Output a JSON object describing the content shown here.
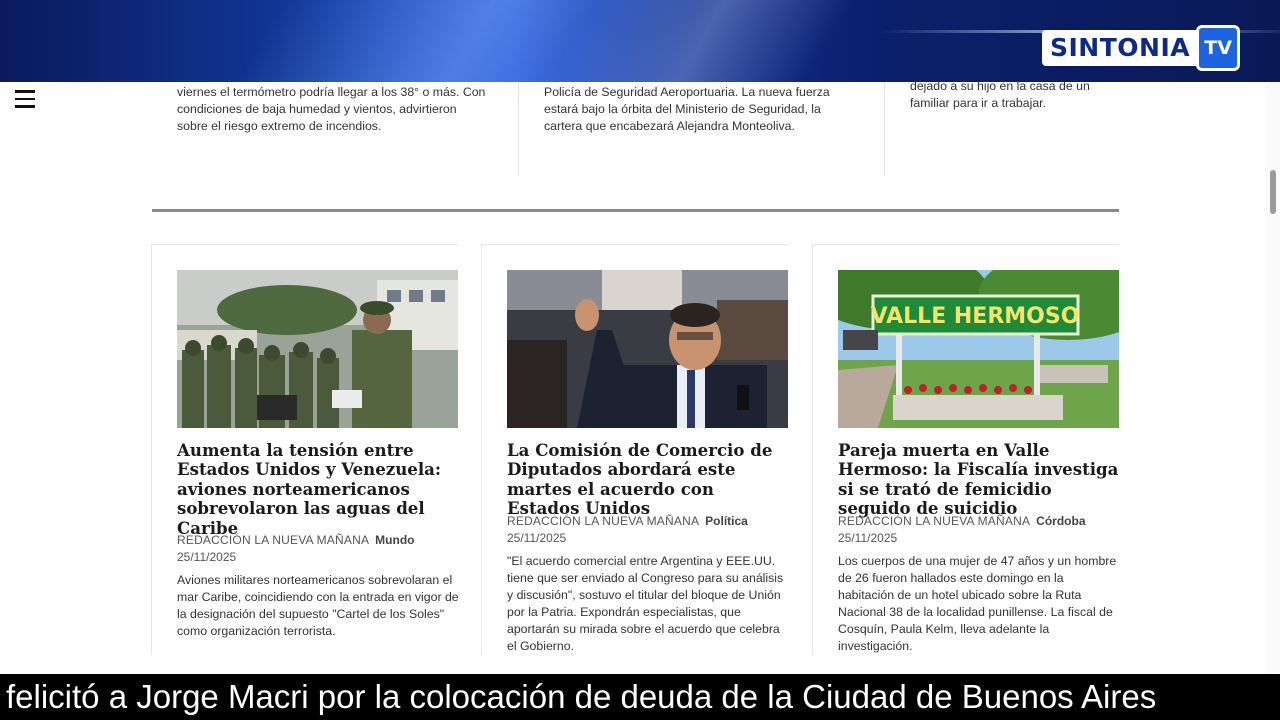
{
  "brand": {
    "logo_text": "SINTONIA",
    "logo_tv": "TV"
  },
  "top_row": [
    {
      "text": "viernes el termómetro podría llegar a los 38° o más. Con condiciones de baja humedad y vientos, advirtieron sobre el riesgo extremo de incendios."
    },
    {
      "text": "Policía de Seguridad Aeroportuaria. La nueva fuerza estará bajo la órbita del Ministerio de Seguridad, la cartera que encabezará Alejandra Monteoliva."
    },
    {
      "text": "dejado a su hijo en la casa de un familiar para ir a trabajar."
    }
  ],
  "articles": [
    {
      "title": "Aumenta la tensión entre Estados Unidos y Venezuela: aviones norteamericanos sobrevolaron las aguas del Caribe",
      "author": "REDACCIÓN LA NUEVA MAÑANA",
      "section": "Mundo",
      "date": "25/11/2025",
      "excerpt": "Aviones militares norteamericanos sobrevolaran el mar Caribe, coincidiendo con la entrada en vigor de la designación del supuesto \"Cartel de los Soles\" como organización terrorista."
    },
    {
      "title": "La Comisión de Comercio de Diputados abordará este martes el acuerdo con Estados Unidos",
      "author": "REDACCIÓN LA NUEVA MAÑANA",
      "section": "Política",
      "date": "25/11/2025",
      "excerpt": "\"El acuerdo comercial entre Argentina y EEE.UU. tiene que ser enviado al Congreso para su análisis y discusión\", sostuvo el titular del bloque de Unión por la Patria. Expondrán especialistas, que aportarán su mirada sobre el acuerdo que celebra el Gobierno."
    },
    {
      "title": "Pareja muerta en Valle Hermoso: la Fiscalía investiga si se trató de femicidio seguido de suicidio",
      "author": "REDACCIÓN LA NUEVA MAÑANA",
      "section": "Córdoba",
      "date": "25/11/2025",
      "excerpt": "Los cuerpos de una mujer de 47 años y un hombre de 26 fueron hallados este domingo en la habitación de un hotel ubicado sobre la Ruta Nacional 38 de la localidad punillense. La fiscal de Cosquín, Paula Kelm, lleva adelante la investigación.",
      "photo_sign": "VALLE HERMOSO"
    }
  ],
  "ticker": {
    "text": "felicitó a Jorge Macri por la colocación de deuda de la Ciudad de Buenos Aires"
  },
  "colors": {
    "banner": "#0d2a86",
    "accent": "#1e63e0",
    "ticker_bg": "#000000"
  }
}
